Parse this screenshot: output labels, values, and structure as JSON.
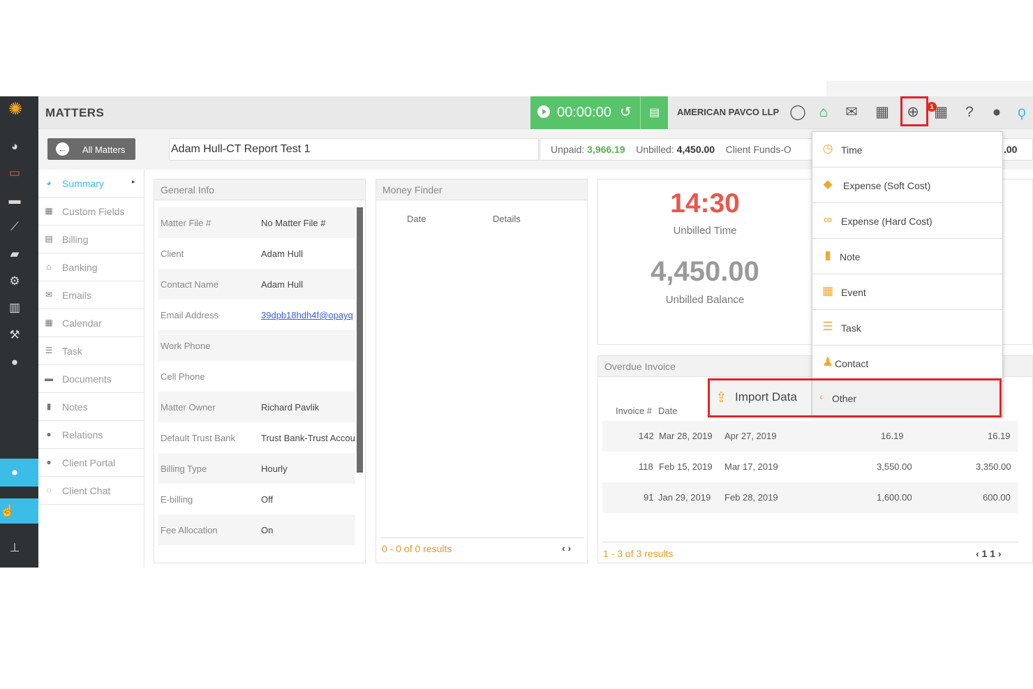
{
  "header": {
    "title": "MATTERS",
    "timer": "00:00:00",
    "firm": "AMERICAN PAVCO LLP",
    "notification_count": "1"
  },
  "toolbar": {
    "all_matters": "All Matters",
    "matter_name": "Adam Hull-CT Report Test 1",
    "unpaid_label": "Unpaid:",
    "unpaid_value": "3,966.19",
    "unbilled_label": "Unbilled:",
    "unbilled_value": "4,450.00",
    "client_funds_label": "Client Funds-O",
    "trailing_value": ".00"
  },
  "sidebar": {
    "items": [
      {
        "label": "Summary",
        "icon": "dashboard-icon"
      },
      {
        "label": "Custom Fields",
        "icon": "grid-icon"
      },
      {
        "label": "Billing",
        "icon": "calculator-icon"
      },
      {
        "label": "Banking",
        "icon": "bank-icon"
      },
      {
        "label": "Emails",
        "icon": "envelope-icon"
      },
      {
        "label": "Calendar",
        "icon": "calendar-icon"
      },
      {
        "label": "Task",
        "icon": "task-icon"
      },
      {
        "label": "Documents",
        "icon": "folder-icon"
      },
      {
        "label": "Notes",
        "icon": "note-icon"
      },
      {
        "label": "Relations",
        "icon": "users-icon"
      },
      {
        "label": "Client Portal",
        "icon": "portal-icon"
      },
      {
        "label": "Client Chat",
        "icon": "chat-icon"
      }
    ]
  },
  "general_info": {
    "title": "General Info",
    "rows": [
      {
        "key": "Matter File #",
        "value": "No Matter File #"
      },
      {
        "key": "Client",
        "value": "Adam Hull"
      },
      {
        "key": "Contact Name",
        "value": "Adam Hull"
      },
      {
        "key": "Email Address",
        "value": "39dpb18hdh4f@opayq"
      },
      {
        "key": "Work Phone",
        "value": ""
      },
      {
        "key": "Cell Phone",
        "value": ""
      },
      {
        "key": "Matter Owner",
        "value": "Richard Pavlik"
      },
      {
        "key": "Default Trust Bank",
        "value": "Trust Bank-Trust Account"
      },
      {
        "key": "Billing Type",
        "value": "Hourly"
      },
      {
        "key": "E-billing",
        "value": "Off"
      },
      {
        "key": "Fee Allocation",
        "value": "On"
      }
    ]
  },
  "money_finder": {
    "title": "Money Finder",
    "col_date": "Date",
    "col_details": "Details",
    "footer": "0 - 0 of 0 results",
    "nav": "‹ ›"
  },
  "stats": {
    "unbilled_time": "14:30",
    "unbilled_time_label": "Unbilled Time",
    "unbilled_balance": "4,450.00",
    "unbilled_balance_label": "Unbilled Balance"
  },
  "overdue_invoice": {
    "title": "Overdue Invoice",
    "col_invoice": "Invoice #",
    "col_date": "Date",
    "rows": [
      {
        "num": "142",
        "date": "Mar 28, 2019",
        "due": "Apr 27, 2019",
        "amount": "16.19",
        "balance": "16.19"
      },
      {
        "num": "118",
        "date": "Feb 15, 2019",
        "due": "Mar 17, 2019",
        "amount": "3,550.00",
        "balance": "3,350.00"
      },
      {
        "num": "91",
        "date": "Jan 29, 2019",
        "due": "Feb 28, 2019",
        "amount": "1,600.00",
        "balance": "600.00"
      }
    ],
    "footer": "1 - 3 of 3 results",
    "nav": "‹ 1 1 ›"
  },
  "add_menu": {
    "items": [
      {
        "label": "Time",
        "icon": "clock-icon"
      },
      {
        "label": "Expense (Soft Cost)",
        "icon": "tags-icon"
      },
      {
        "label": "Expense (Hard Cost)",
        "icon": "link-icon"
      },
      {
        "label": "Note",
        "icon": "file-icon"
      },
      {
        "label": "Event",
        "icon": "calendar-icon"
      },
      {
        "label": "Task",
        "icon": "tasks-icon"
      },
      {
        "label": "Contact",
        "icon": "person-icon"
      }
    ],
    "other": "Other",
    "import_data": "Import Data"
  },
  "colors": {
    "accent": "#3bbde7",
    "timer_green": "#58c46a",
    "highlight_red": "#e2222a",
    "orange": "#f0a830"
  }
}
